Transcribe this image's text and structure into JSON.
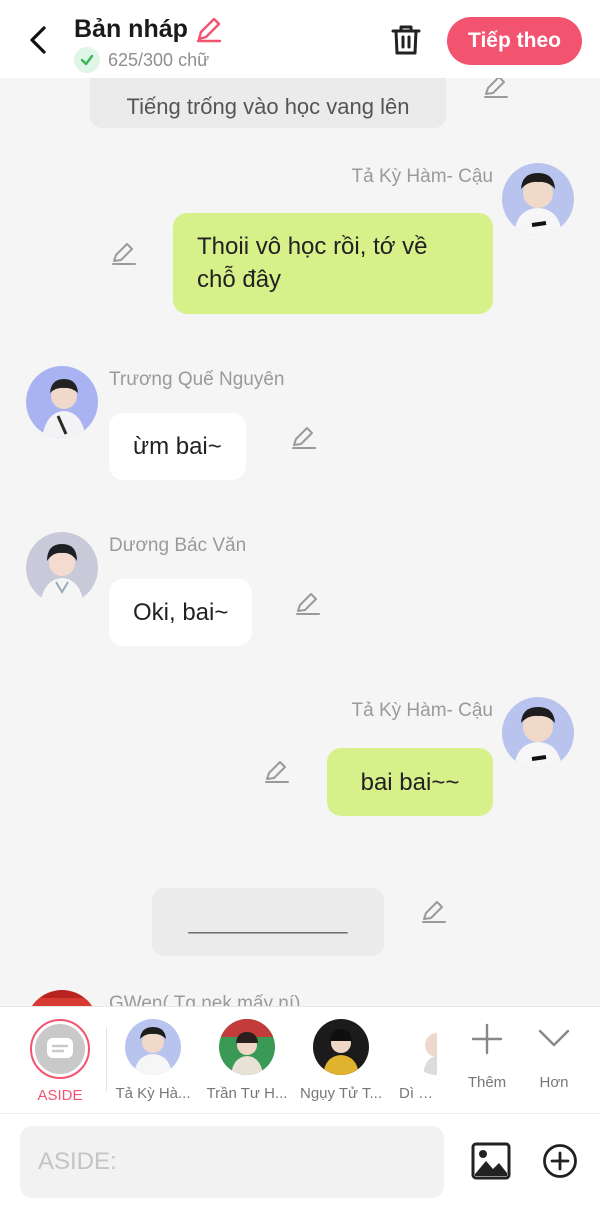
{
  "header": {
    "title": "Bản nháp",
    "word_count": "625/300 chữ",
    "next_label": "Tiếp theo"
  },
  "messages": [
    {
      "type": "narration",
      "text": "Tiếng trống vào học vang lên"
    },
    {
      "type": "right",
      "name": "Tả Kỳ Hàm- Cậu",
      "lines": [
        "Thoii vô học rồi, tớ về",
        "chỗ đây"
      ]
    },
    {
      "type": "left",
      "name": "Trương Quế Nguyên",
      "text": "ừm bai~"
    },
    {
      "type": "left",
      "name": "Dương Bác Văn",
      "text": "Oki, bai~"
    },
    {
      "type": "right",
      "name": "Tả Kỳ Hàm- Cậu",
      "text": "bai bai~~"
    },
    {
      "type": "narration",
      "text": "_____________"
    },
    {
      "type": "left",
      "name": "GWen( Tg nek mấy ní)"
    }
  ],
  "characters": [
    {
      "label": "ASIDE",
      "icon": "chat-bubble-icon",
      "selected": true
    },
    {
      "label": "Tả Kỳ Hà..."
    },
    {
      "label": "Trần Tư H..."
    },
    {
      "label": "Ngụy Tử T..."
    },
    {
      "label": "Dì ca..."
    }
  ],
  "more": {
    "add_label": "Thêm",
    "more_label": "Hơn"
  },
  "input": {
    "placeholder": "ASIDE:"
  },
  "colors": {
    "accent": "#f2536f",
    "green_bubble": "#d6f08a",
    "background": "#f5f5f5"
  }
}
